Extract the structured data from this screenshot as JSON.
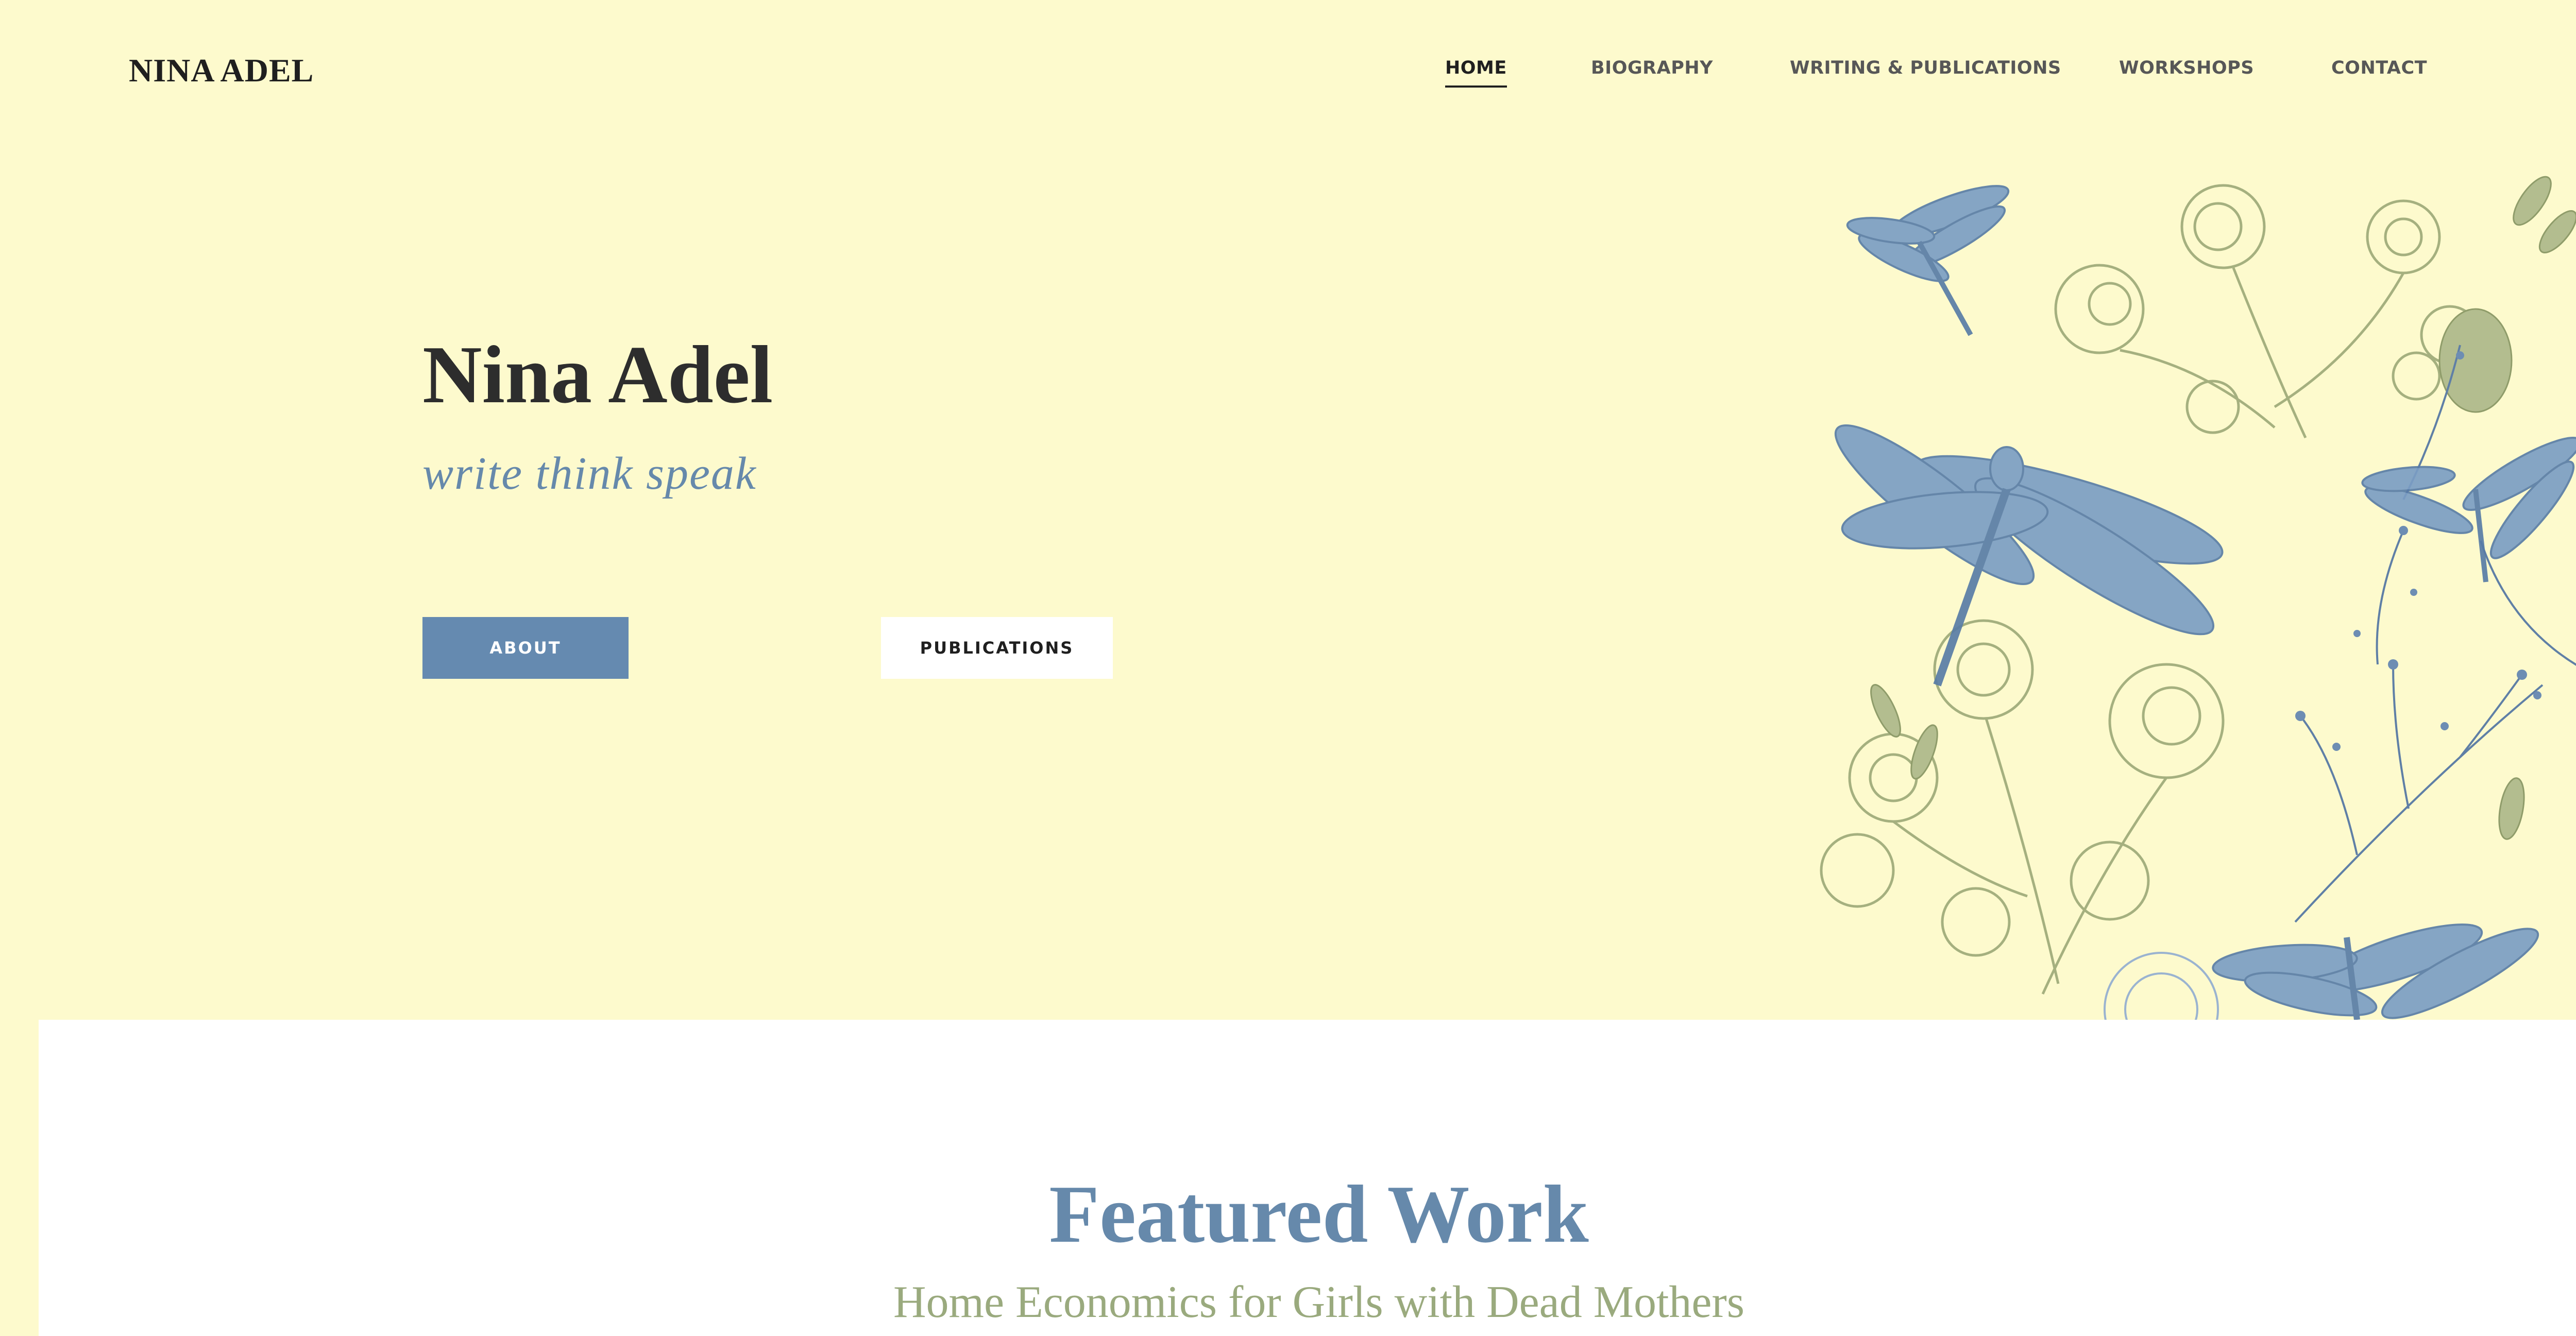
{
  "header": {
    "logo": "NINA ADEL",
    "nav": [
      {
        "label": "HOME",
        "active": true
      },
      {
        "label": "BIOGRAPHY",
        "active": false
      },
      {
        "label": "WRITING & PUBLICATIONS",
        "active": false
      },
      {
        "label": "WORKSHOPS",
        "active": false
      },
      {
        "label": "CONTACT",
        "active": false
      }
    ]
  },
  "hero": {
    "title": "Nina Adel",
    "tagline": "write think speak",
    "about_label": "ABOUT",
    "publications_label": "PUBLICATIONS",
    "illustration": "dragonflies-and-botanical-sketches"
  },
  "featured": {
    "title": "Featured Work",
    "subtitle": "Home Economics for Girls with Dead Mothers"
  },
  "colors": {
    "background": "#fdfacd",
    "accent_blue": "#658ab0",
    "sage_green": "#9aaa7e",
    "text_dark": "#2d2d2d"
  }
}
